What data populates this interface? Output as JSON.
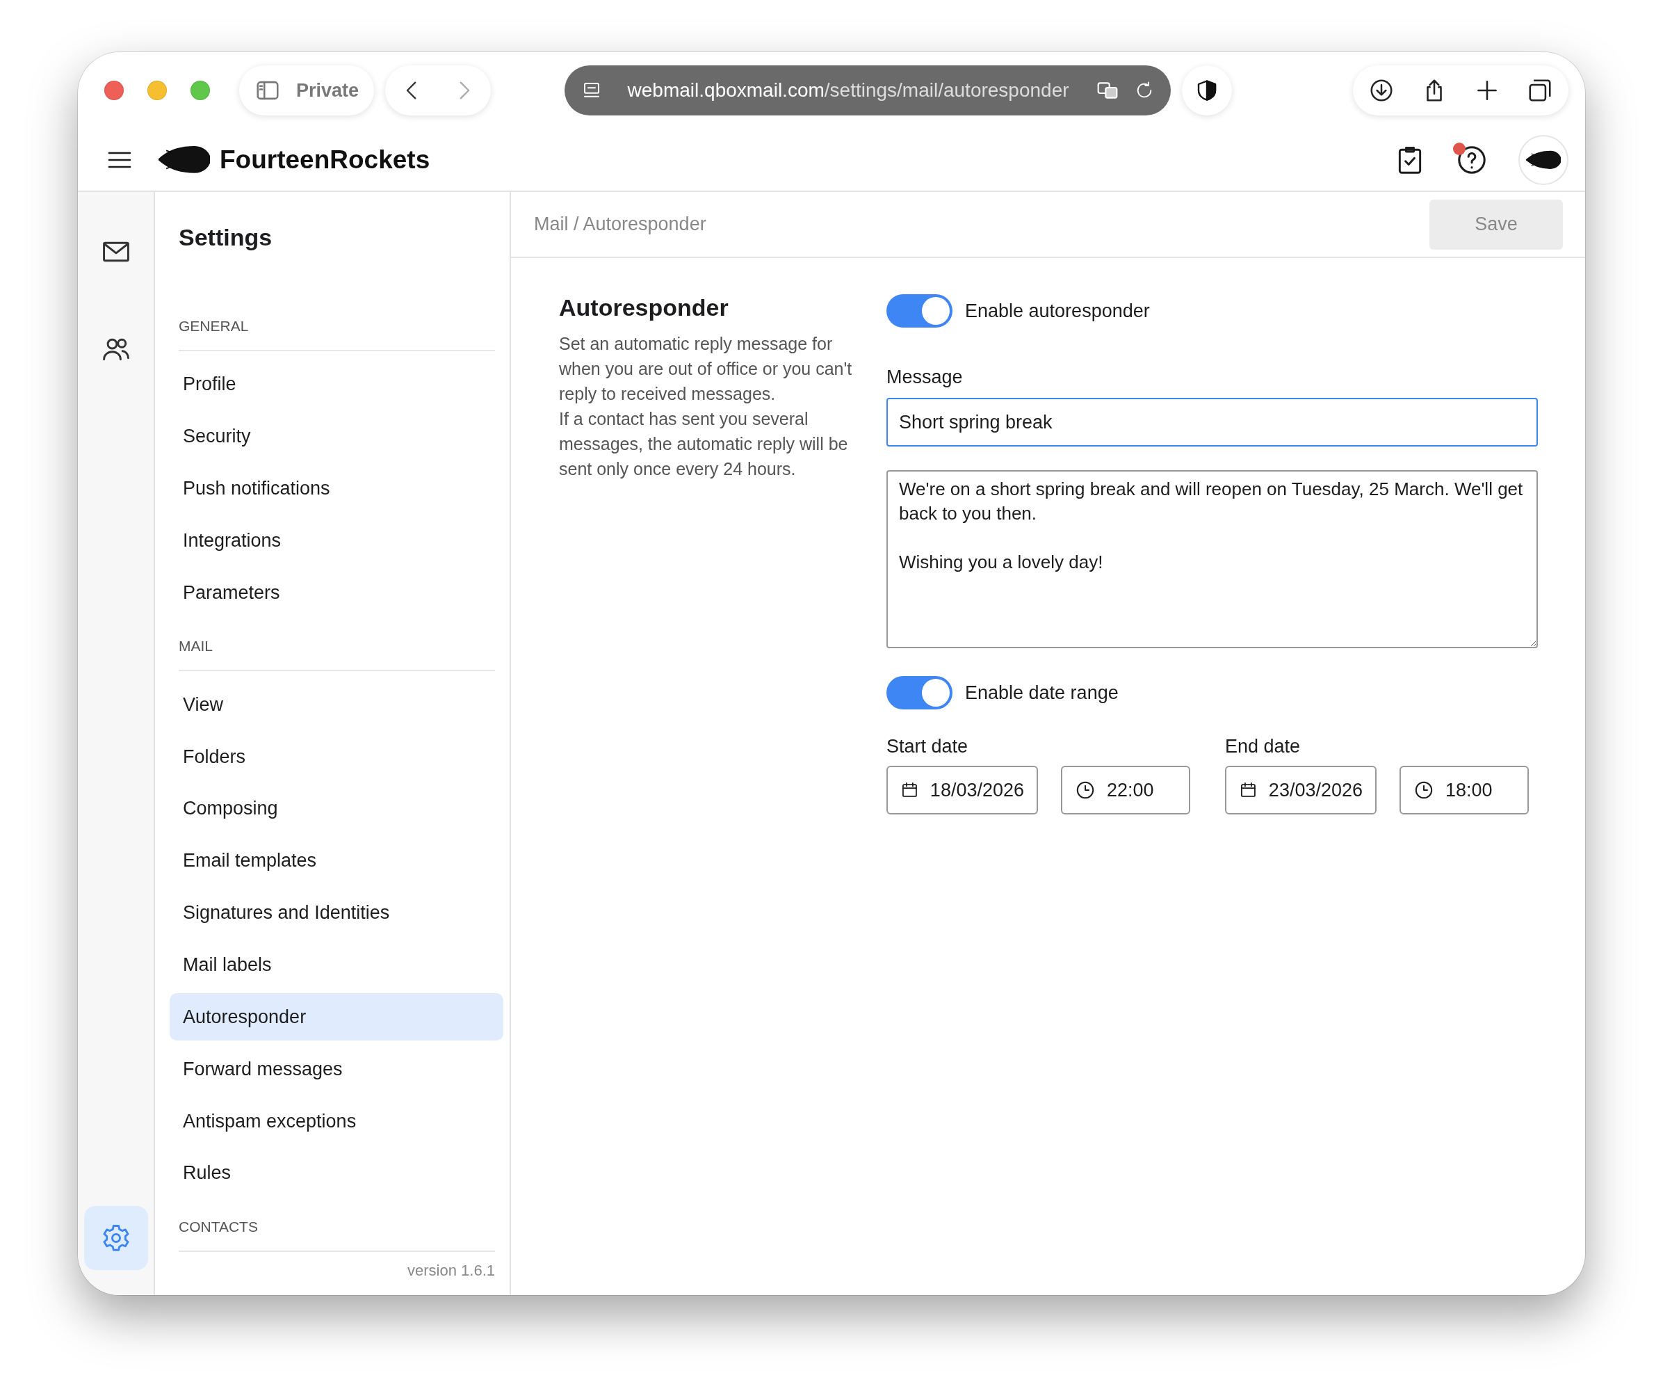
{
  "browser": {
    "private_label": "Private",
    "url": {
      "host": "webmail.qboxmail.com",
      "path": "/settings/mail/autoresponder"
    }
  },
  "app_header": {
    "brand": "FourteenRockets",
    "help_notification": true
  },
  "rail": {
    "items": [
      {
        "kind": "mail",
        "selected": false
      },
      {
        "kind": "contacts",
        "selected": false
      }
    ],
    "settings": {
      "selected": true
    }
  },
  "sidebar": {
    "title": "Settings",
    "sections": [
      {
        "heading": "GENERAL",
        "items": [
          {
            "label": "Profile",
            "selected": false
          },
          {
            "label": "Security",
            "selected": false
          },
          {
            "label": "Push notifications",
            "selected": false
          },
          {
            "label": "Integrations",
            "selected": false
          },
          {
            "label": "Parameters",
            "selected": false
          }
        ]
      },
      {
        "heading": "MAIL",
        "items": [
          {
            "label": "View",
            "selected": false
          },
          {
            "label": "Folders",
            "selected": false
          },
          {
            "label": "Composing",
            "selected": false
          },
          {
            "label": "Email templates",
            "selected": false
          },
          {
            "label": "Signatures and Identities",
            "selected": false
          },
          {
            "label": "Mail labels",
            "selected": false
          },
          {
            "label": "Autoresponder",
            "selected": true
          },
          {
            "label": "Forward messages",
            "selected": false
          },
          {
            "label": "Antispam exceptions",
            "selected": false
          },
          {
            "label": "Rules",
            "selected": false
          }
        ]
      },
      {
        "heading": "CONTACTS"
      }
    ],
    "version": "version 1.6.1"
  },
  "breadcrumb": "Mail / Autoresponder",
  "save_button": {
    "label": "Save",
    "disabled": true
  },
  "autoresponder": {
    "title": "Autoresponder",
    "description": [
      "Set an automatic reply message for when you are out of office or you can't reply to received messages.",
      "If a contact has sent you several messages, the automatic reply will be sent only once every 24 hours."
    ],
    "enable": {
      "label": "Enable autoresponder",
      "on": true
    },
    "message": {
      "label": "Message",
      "subject": "Short spring break",
      "body": "We're on a short spring break and will reopen on Tuesday, 25 March. We'll get back to you then.\n\nWishing you a lovely day!"
    },
    "date_range": {
      "label": "Enable date range",
      "on": true
    },
    "start": {
      "label": "Start date",
      "date": "18/03/2026",
      "time": "22:00"
    },
    "end": {
      "label": "End date",
      "date": "23/03/2026",
      "time": "18:00"
    }
  }
}
